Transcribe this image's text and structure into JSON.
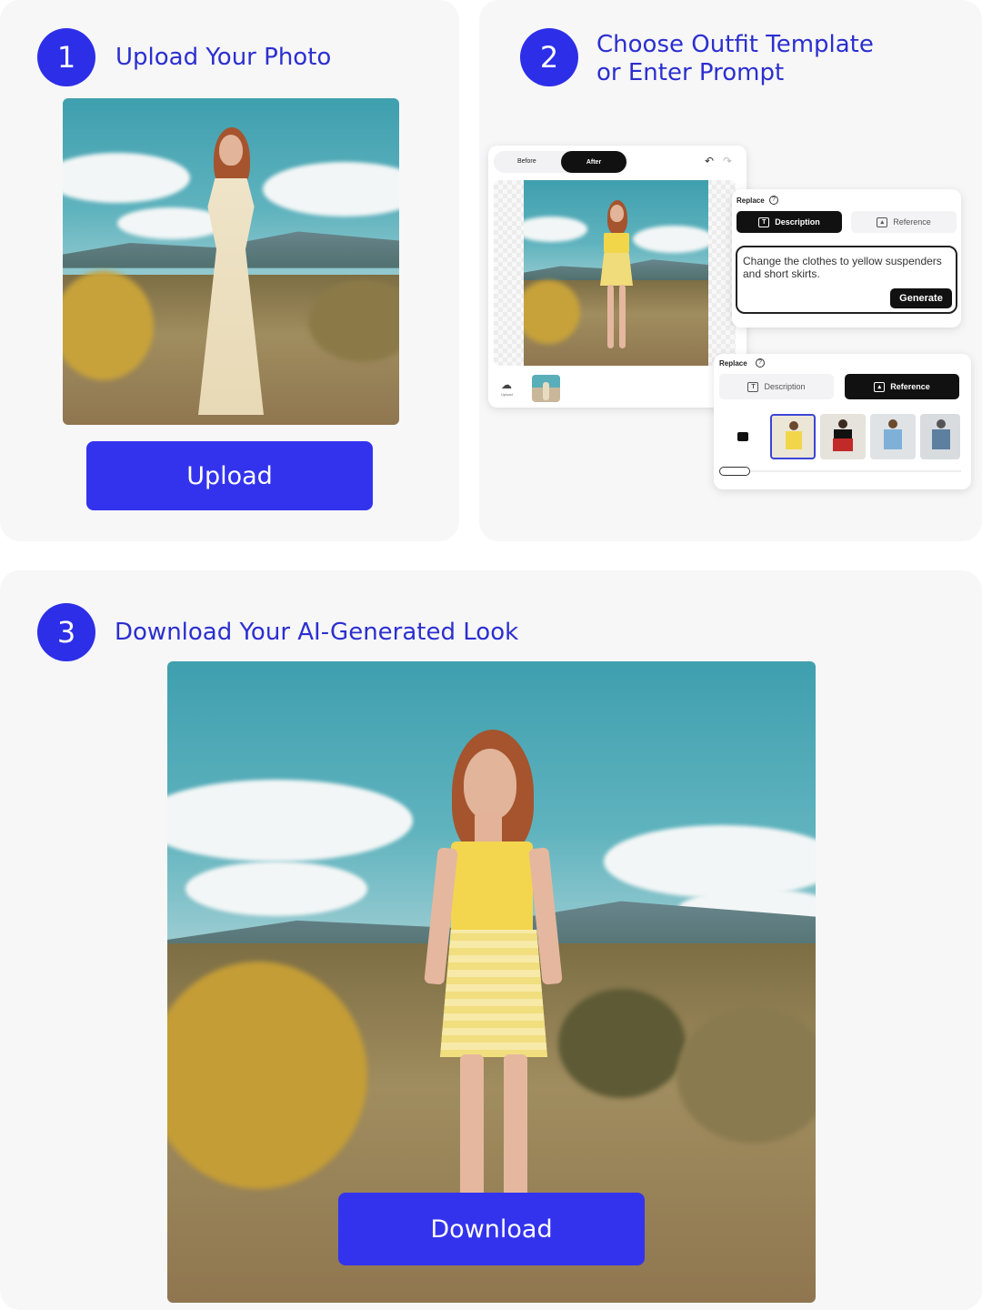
{
  "steps": [
    {
      "number": "1",
      "title": "Upload Your Photo",
      "button": "Upload"
    },
    {
      "number": "2",
      "title_line1": "Choose Outfit Template",
      "title_line2": "or Enter Prompt"
    },
    {
      "number": "3",
      "title": "Download Your AI-Generated Look",
      "button": "Download"
    }
  ],
  "editor": {
    "toggle_before": "Before",
    "toggle_after": "After",
    "upload_label": "Upload",
    "replace_label": "Replace",
    "description_tab": "Description",
    "reference_tab": "Reference",
    "prompt_text": "Change the clothes to yellow suspenders and short skirts.",
    "generate_button": "Generate"
  },
  "colors": {
    "accent": "#2d2ee8",
    "button": "#3333ee",
    "title_text": "#2b2fd0",
    "panel_bg": "#f7f7f8"
  },
  "icons": [
    "help-circle-icon",
    "text-t-icon",
    "image-add-icon",
    "undo-icon",
    "redo-icon",
    "cloud-upload-icon",
    "image-icon"
  ]
}
